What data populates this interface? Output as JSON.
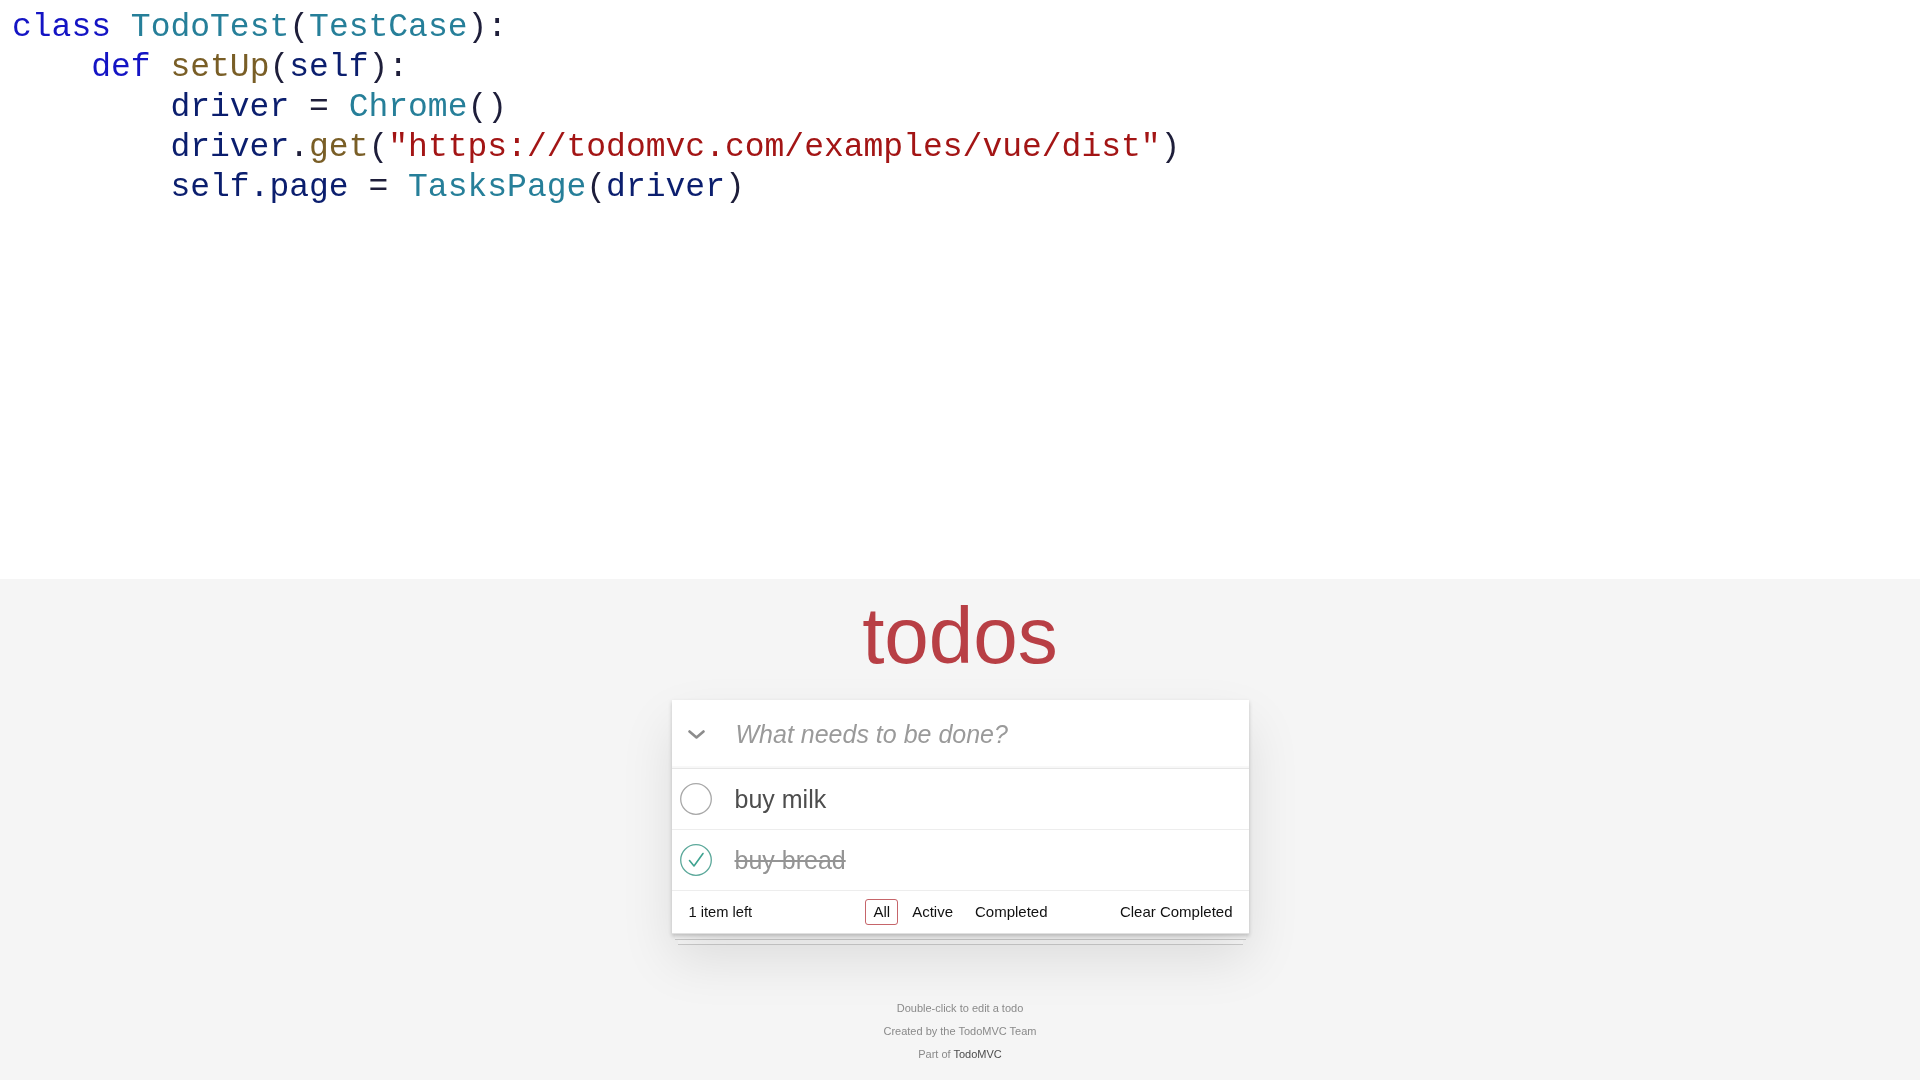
{
  "code": {
    "lines": [
      {
        "tokens": [
          {
            "kind": "keyword",
            "text": "class "
          },
          {
            "kind": "class",
            "text": "TodoTest"
          },
          {
            "kind": "plain",
            "text": "("
          },
          {
            "kind": "class",
            "text": "TestCase"
          },
          {
            "kind": "plain",
            "text": "):"
          }
        ],
        "children": [
          {
            "tokens": [
              {
                "kind": "keyword",
                "text": "def "
              },
              {
                "kind": "function",
                "text": "setUp"
              },
              {
                "kind": "plain",
                "text": "("
              },
              {
                "kind": "variable",
                "text": "self"
              },
              {
                "kind": "plain",
                "text": "):"
              }
            ],
            "children": [
              {
                "tokens": [
                  {
                    "kind": "variable",
                    "text": "driver"
                  },
                  {
                    "kind": "plain",
                    "text": " = "
                  },
                  {
                    "kind": "class",
                    "text": "Chrome"
                  },
                  {
                    "kind": "plain",
                    "text": "()"
                  }
                ]
              },
              {
                "tokens": [
                  {
                    "kind": "variable",
                    "text": "driver"
                  },
                  {
                    "kind": "plain",
                    "text": "."
                  },
                  {
                    "kind": "function",
                    "text": "get"
                  },
                  {
                    "kind": "plain",
                    "text": "("
                  },
                  {
                    "kind": "string",
                    "text": "\"https://todomvc.com/examples/vue/dist\""
                  },
                  {
                    "kind": "plain",
                    "text": ")"
                  }
                ]
              },
              {
                "tokens": [
                  {
                    "kind": "variable",
                    "text": "self.page"
                  },
                  {
                    "kind": "plain",
                    "text": " = "
                  },
                  {
                    "kind": "class",
                    "text": "TasksPage"
                  },
                  {
                    "kind": "plain",
                    "text": "("
                  },
                  {
                    "kind": "variable",
                    "text": "driver"
                  },
                  {
                    "kind": "plain",
                    "text": ")"
                  }
                ]
              }
            ]
          }
        ]
      }
    ]
  },
  "todo_app": {
    "title": "todos",
    "new_todo": {
      "placeholder": "What needs to be done?"
    },
    "todos": [
      {
        "text": "buy milk",
        "completed": false
      },
      {
        "text": "buy bread",
        "completed": true
      }
    ],
    "footer": {
      "count": "1 item left",
      "filters": [
        {
          "label": "All",
          "selected": true
        },
        {
          "label": "Active",
          "selected": false
        },
        {
          "label": "Completed",
          "selected": false
        }
      ],
      "clear_completed": "Clear Completed"
    }
  },
  "info": {
    "edit_hint": "Double-click to edit a todo",
    "credit": "Created by the TodoMVC Team",
    "part_of": {
      "text": "Part of",
      "link": "TodoMVC"
    }
  }
}
